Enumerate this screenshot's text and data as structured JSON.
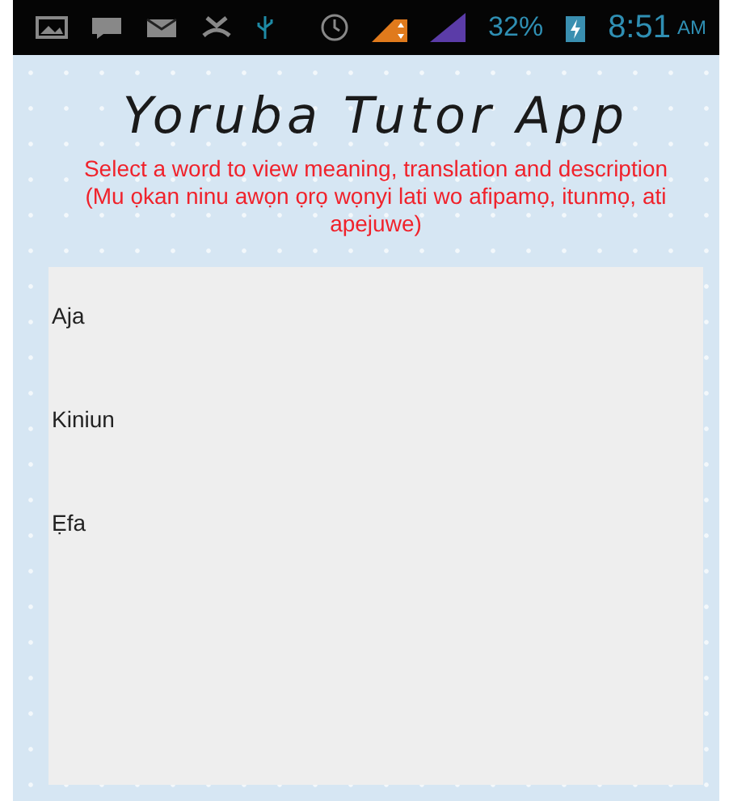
{
  "status_bar": {
    "battery_percent": "32%",
    "time": "8:51",
    "meridiem": "AM"
  },
  "title": "Yoruba Tutor App",
  "instructions": [
    "Select a word to view meaning, translation and description",
    "(Mu ọkan ninu awọn ọrọ wọnyi lati wo afipamọ, itunmọ, ati apejuwe)"
  ],
  "words": [
    {
      "label": "Aja"
    },
    {
      "label": "Kiniun"
    },
    {
      "label": "Ẹfa"
    }
  ]
}
